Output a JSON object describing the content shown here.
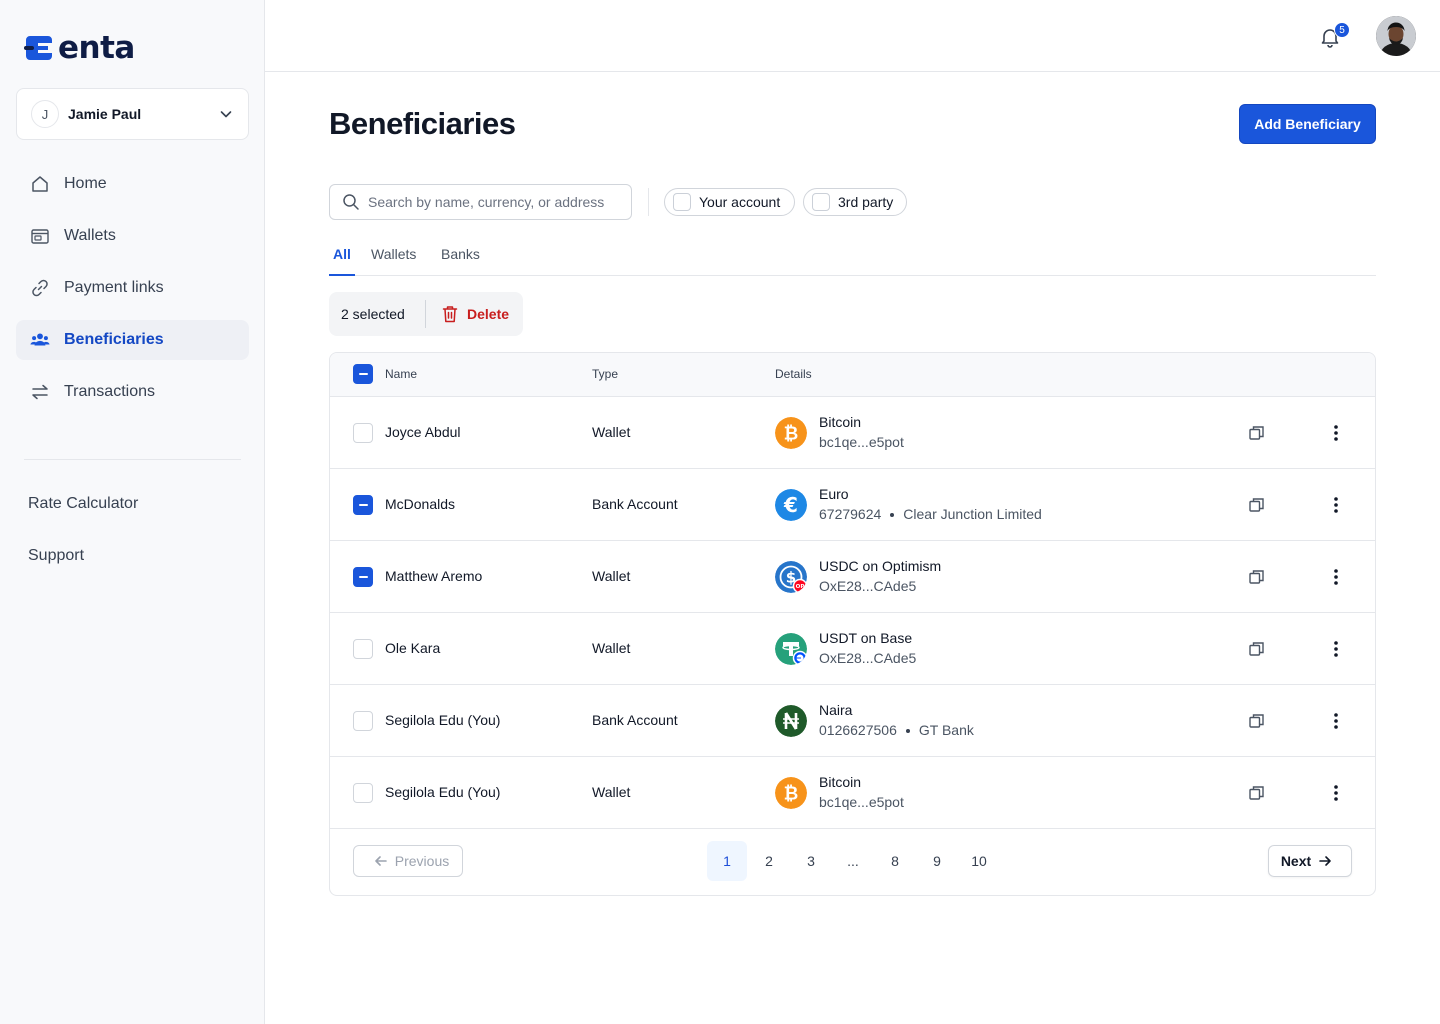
{
  "brand": {
    "name": "enta"
  },
  "account": {
    "initial": "J",
    "name": "Jamie Paul"
  },
  "nav": [
    {
      "label": "Home",
      "icon": "home-icon",
      "active": false
    },
    {
      "label": "Wallets",
      "icon": "wallet-icon",
      "active": false
    },
    {
      "label": "Payment links",
      "icon": "link-icon",
      "active": false
    },
    {
      "label": "Beneficiaries",
      "icon": "users-icon",
      "active": true
    },
    {
      "label": "Transactions",
      "icon": "arrows-swap-icon",
      "active": false
    }
  ],
  "secondary_nav": [
    "Rate Calculator",
    "Support"
  ],
  "header": {
    "notification_count": "5"
  },
  "page": {
    "title": "Beneficiaries",
    "add_button": "Add Beneficiary"
  },
  "filters": {
    "search_placeholder": "Search by name, currency, or address",
    "your_account": "Your account",
    "third_party": "3rd party"
  },
  "tabs": [
    "All",
    "Wallets",
    "Banks"
  ],
  "bulk": {
    "selected_text": "2 selected",
    "delete_label": "Delete"
  },
  "table": {
    "columns": [
      "Name",
      "Type",
      "Details"
    ],
    "rows": [
      {
        "name": "Joyce Abdul",
        "type": "Wallet",
        "currency": "Bitcoin",
        "detail": "bc1qe...e5pot",
        "detail_extra": "",
        "selected": false,
        "coin": "bitcoin-icon"
      },
      {
        "name": "McDonalds",
        "type": "Bank Account",
        "currency": "Euro",
        "detail": "67279624",
        "detail_extra": "Clear Junction Limited",
        "selected": true,
        "coin": "euro-icon"
      },
      {
        "name": "Matthew Aremo",
        "type": "Wallet",
        "currency": "USDC on Optimism",
        "detail": "OxE28...CAde5",
        "detail_extra": "",
        "selected": true,
        "coin": "usdc-icon"
      },
      {
        "name": "Ole Kara",
        "type": "Wallet",
        "currency": "USDT on Base",
        "detail": "OxE28...CAde5",
        "detail_extra": "",
        "selected": false,
        "coin": "usdt-icon"
      },
      {
        "name": "Segilola Edu (You)",
        "type": "Bank Account",
        "currency": "Naira",
        "detail": "0126627506",
        "detail_extra": "GT Bank",
        "selected": false,
        "coin": "naira-icon"
      },
      {
        "name": "Segilola Edu (You)",
        "type": "Wallet",
        "currency": "Bitcoin",
        "detail": "bc1qe...e5pot",
        "detail_extra": "",
        "selected": false,
        "coin": "bitcoin-icon"
      }
    ]
  },
  "pagination": {
    "previous": "Previous",
    "next": "Next",
    "pages": [
      "1",
      "2",
      "3",
      "...",
      "8",
      "9",
      "10"
    ],
    "current": "1"
  },
  "colors": {
    "accent": "#1a56db",
    "danger": "#c81e1e",
    "bitcoin": "#f7931a",
    "euro": "#1e88e5",
    "usdc": "#2775ca",
    "usdt": "#26a17b",
    "naira": "#1f5a2a"
  }
}
